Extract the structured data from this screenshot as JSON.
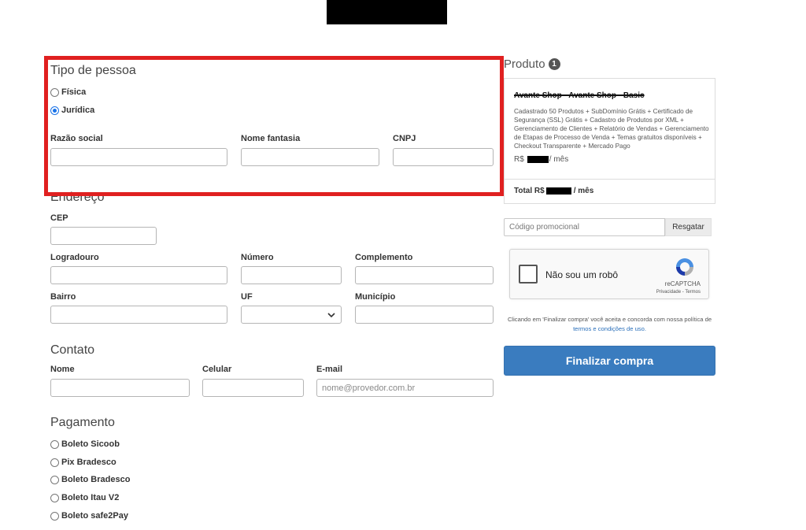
{
  "tipo_pessoa": {
    "title": "Tipo de pessoa",
    "options": [
      {
        "label": "Física",
        "checked": false
      },
      {
        "label": "Jurídica",
        "checked": true
      }
    ],
    "razao_social_label": "Razão social",
    "nome_fantasia_label": "Nome fantasia",
    "cnpj_label": "CNPJ"
  },
  "endereco": {
    "title": "Endereço",
    "cep_label": "CEP",
    "logradouro_label": "Logradouro",
    "numero_label": "Número",
    "complemento_label": "Complemento",
    "bairro_label": "Bairro",
    "uf_label": "UF",
    "municipio_label": "Município"
  },
  "contato": {
    "title": "Contato",
    "nome_label": "Nome",
    "celular_label": "Celular",
    "email_label": "E-mail",
    "email_placeholder": "nome@provedor.com.br"
  },
  "pagamento": {
    "title": "Pagamento",
    "options": [
      "Boleto Sicoob",
      "Pix Bradesco",
      "Boleto Bradesco",
      "Boleto Itau V2",
      "Boleto safe2Pay"
    ]
  },
  "produto": {
    "title": "Produto",
    "count": "1",
    "name": "Avante Shop - Avante Shop - Basic",
    "description": "Cadastrado 50 Produtos + SubDomínio Grátis + Certificado de Segurança (SSL) Grátis + Cadastro de Produtos por XML + Gerenciamento de Clientes + Relatório de Vendas + Gerenciamento de Etapas de Processo de Venda + Temas gratuitos disponíveis + Checkout Transparente + Mercado Pago",
    "price_prefix": "R$",
    "price_suffix": "/ mês",
    "total_prefix": "Total R$",
    "total_suffix": "/ mês"
  },
  "promo": {
    "placeholder": "Código promocional",
    "button_label": "Resgatar"
  },
  "recaptcha": {
    "label": "Não sou um robô",
    "brand": "reCAPTCHA",
    "links": "Privacidade - Termos"
  },
  "terms": {
    "text_before": "Clicando em 'Finalizar compra' você aceita e concorda com nossa política de ",
    "link_text": "termos e condições de uso.",
    "text_after": ""
  },
  "checkout": {
    "button_label": "Finalizar compra"
  },
  "colors": {
    "highlight": "#e02020",
    "primary_button": "#3a7cbf",
    "link": "#2a6fba"
  }
}
